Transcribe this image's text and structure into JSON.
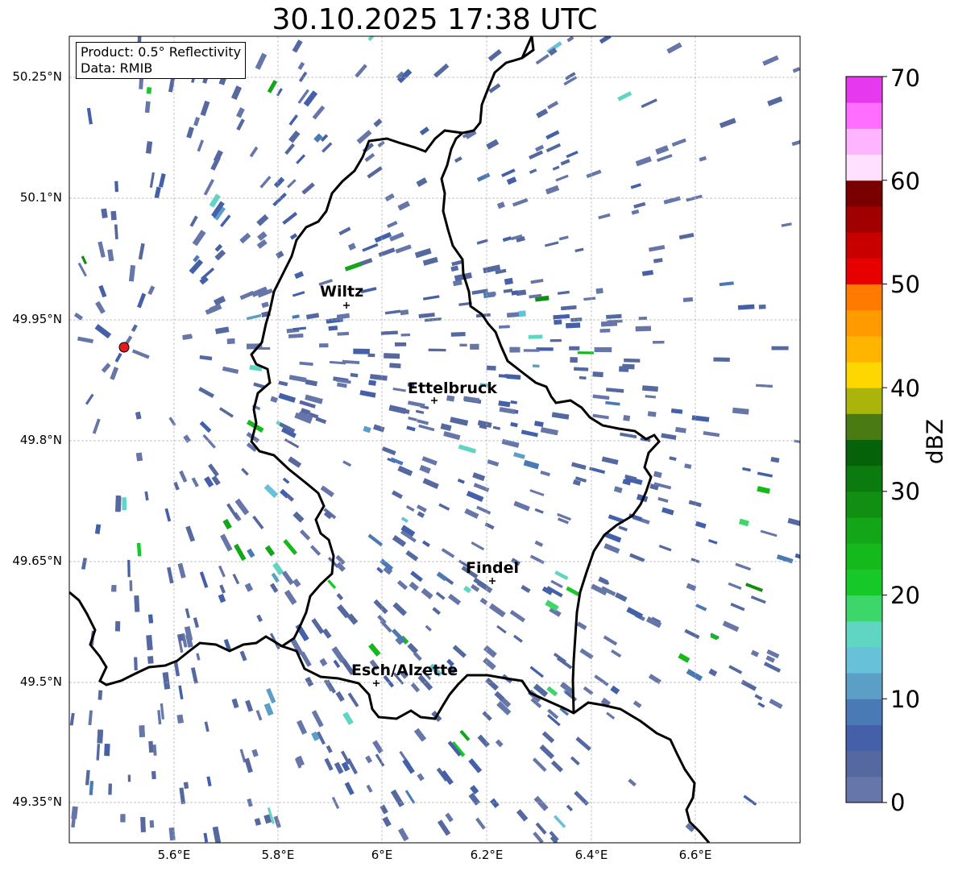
{
  "title": "30.10.2025 17:38 UTC",
  "info": {
    "product": "Product: 0.5° Reflectivity",
    "source": "Data: RMIB"
  },
  "map": {
    "lat_labels": [
      "50.25°N",
      "50.1°N",
      "49.95°N",
      "49.8°N",
      "49.65°N",
      "49.5°N",
      "49.35°N"
    ],
    "lon_labels": [
      "5.6°E",
      "5.8°E",
      "6°E",
      "6.2°E",
      "6.4°E",
      "6.6°E"
    ],
    "places": [
      {
        "name": "Wiltz"
      },
      {
        "name": "Ettelbruck"
      },
      {
        "name": "Findel"
      },
      {
        "name": "Esch/Alzette"
      }
    ],
    "radar_marker_color": "#e41a1c",
    "border_color": "#000000"
  },
  "colorbar": {
    "label": "dBZ",
    "ticks": [
      "0",
      "10",
      "20",
      "30",
      "40",
      "50",
      "60",
      "70"
    ],
    "colors": [
      "#6676a9",
      "#5568a0",
      "#4460a8",
      "#4a7ab5",
      "#5b9ec6",
      "#67c2d9",
      "#5fd5c2",
      "#3dd66a",
      "#17c928",
      "#15b91b",
      "#13a618",
      "#108f12",
      "#0b7a0f",
      "#066208",
      "#4a7a12",
      "#aab40a",
      "#ffd700",
      "#ffb400",
      "#ff9b00",
      "#ff7a00",
      "#e60000",
      "#c80000",
      "#a00000",
      "#780000",
      "#ffe0ff",
      "#ffb4ff",
      "#ff6eff",
      "#e639ef"
    ]
  }
}
